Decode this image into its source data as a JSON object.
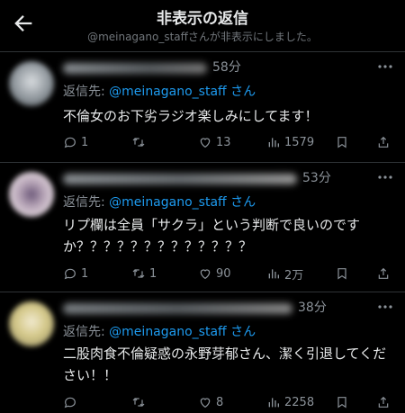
{
  "header": {
    "title": "非表示の返信",
    "subtitle": "@meinagano_staffさんが非表示にしました。"
  },
  "replies": [
    {
      "time": "58分",
      "replying_prefix": "返信先: ",
      "replying_handle": "@meinagano_staff",
      "replying_suffix": " さん",
      "text": "不倫女のお下劣ラジオ楽しみにしてます！",
      "reply_count": "1",
      "retweet_count": "",
      "like_count": "13",
      "view_count": "1579"
    },
    {
      "time": "53分",
      "replying_prefix": "返信先: ",
      "replying_handle": "@meinagano_staff",
      "replying_suffix": " さん",
      "text": "リプ欄は全員「サクラ」という判断で良いのですか？？？？？？？？？？？？？",
      "reply_count": "1",
      "retweet_count": "1",
      "like_count": "90",
      "view_count": "2万"
    },
    {
      "time": "38分",
      "replying_prefix": "返信先: ",
      "replying_handle": "@meinagano_staff",
      "replying_suffix": " さん",
      "text": "二股肉食不倫疑惑の永野芽郁さん、潔く引退してください！！",
      "reply_count": "",
      "retweet_count": "",
      "like_count": "8",
      "view_count": "2258"
    }
  ],
  "icons": {
    "back": "arrow-left-icon",
    "more": "more-dots-icon",
    "reply": "speech-bubble-icon",
    "retweet": "retweet-icon",
    "like": "heart-icon",
    "views": "bar-chart-icon",
    "bookmark": "bookmark-icon",
    "share": "share-icon"
  },
  "colors": {
    "background": "#000000",
    "text": "#e7e9ea",
    "muted": "#71767b",
    "link": "#1d9bf0",
    "divider": "#2f3336"
  }
}
